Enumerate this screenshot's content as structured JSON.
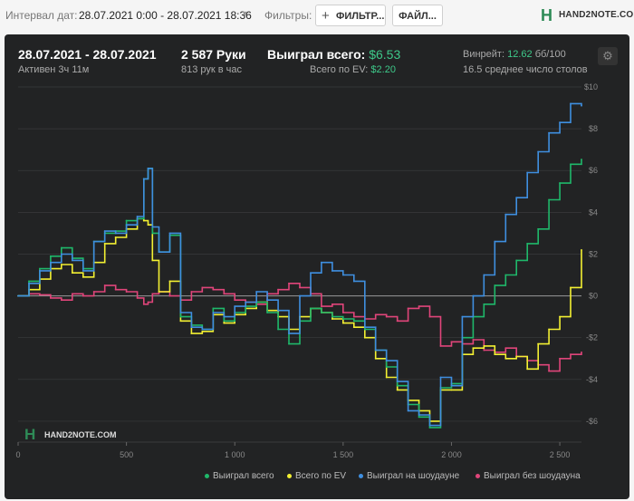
{
  "toolbar": {
    "interval_label": "Интервал дат:",
    "interval_value": "28.07.2021 0:00 - 28.07.2021 18:36",
    "filters_label": "Фильтры:",
    "filter_button": "ФИЛЬТР...",
    "file_button": "ФАЙЛ...",
    "logo_text": "HAND2NOTE.COM"
  },
  "stats": {
    "date_range": "28.07.2021 - 28.07.2021",
    "active": "Активен 3ч 11м",
    "hands": "2 587 Руки",
    "hands_per_hour": "813 рук в час",
    "won_total_label": "Выиграл всего:",
    "won_total_value": "$6.53",
    "ev_label": "Всего по EV:",
    "ev_value": "$2.20",
    "winrate_label": "Винрейт:",
    "winrate_value": "12.62",
    "winrate_unit": "бб/100",
    "avg_tables": "16.5 среднее число столов"
  },
  "watermark": "HAND2NOTE.COM",
  "colors": {
    "green": "#1fb86a",
    "yellow": "#f3f032",
    "blue": "#3f8fe0",
    "pink": "#e0457a"
  },
  "chart_data": {
    "type": "line",
    "xlim": [
      0,
      2600
    ],
    "ylim": [
      -7,
      10
    ],
    "x_ticks": [
      0,
      500,
      1000,
      1500,
      2000,
      2500
    ],
    "x_tick_labels": [
      "0",
      "500",
      "1 000",
      "1 500",
      "2 000",
      "2 500"
    ],
    "y_ticks": [
      -6,
      -4,
      -2,
      0,
      2,
      4,
      6,
      8,
      10
    ],
    "y_tick_labels": [
      "-$6",
      "-$4",
      "-$2",
      "$0",
      "$2",
      "$4",
      "$6",
      "$8",
      "$10"
    ],
    "legend_position": "bottom-right",
    "series": [
      {
        "name": "Выиграл всего",
        "color": "#1fb86a",
        "x": [
          0,
          50,
          100,
          150,
          200,
          250,
          300,
          350,
          400,
          450,
          500,
          550,
          580,
          600,
          620,
          650,
          700,
          750,
          800,
          850,
          900,
          950,
          1000,
          1050,
          1100,
          1150,
          1200,
          1250,
          1300,
          1350,
          1400,
          1450,
          1500,
          1550,
          1600,
          1650,
          1700,
          1750,
          1800,
          1850,
          1900,
          1950,
          2000,
          2050,
          2100,
          2150,
          2200,
          2250,
          2300,
          2350,
          2400,
          2450,
          2500,
          2550,
          2600
        ],
        "y": [
          0,
          0.7,
          1.3,
          1.9,
          2.3,
          1.8,
          1.3,
          2.6,
          3.0,
          3.1,
          3.6,
          3.7,
          5.6,
          6.1,
          3.0,
          2.1,
          2.9,
          -1.0,
          -1.4,
          -1.6,
          -0.6,
          -1.2,
          -0.8,
          -0.5,
          -0.3,
          -0.8,
          -1.6,
          -2.3,
          -1.2,
          -0.6,
          -0.8,
          -1.0,
          -1.1,
          -1.2,
          -1.6,
          -2.6,
          -3.4,
          -4.3,
          -5.2,
          -5.8,
          -6.3,
          -4.4,
          -4.2,
          -2.0,
          -1.0,
          -0.4,
          0.5,
          1.0,
          1.7,
          2.5,
          3.2,
          4.6,
          5.4,
          6.3,
          6.53
        ]
      },
      {
        "name": "Всего по EV",
        "color": "#f3f032",
        "x": [
          0,
          50,
          100,
          150,
          200,
          250,
          300,
          350,
          400,
          450,
          500,
          550,
          580,
          600,
          620,
          650,
          700,
          750,
          800,
          850,
          900,
          950,
          1000,
          1050,
          1100,
          1150,
          1200,
          1250,
          1300,
          1350,
          1400,
          1450,
          1500,
          1550,
          1600,
          1650,
          1700,
          1750,
          1800,
          1850,
          1900,
          1950,
          2000,
          2050,
          2100,
          2150,
          2200,
          2250,
          2300,
          2350,
          2400,
          2450,
          2500,
          2550,
          2600
        ],
        "y": [
          0,
          0.3,
          0.8,
          1.3,
          1.5,
          1.1,
          0.9,
          1.6,
          2.5,
          2.8,
          3.2,
          3.7,
          3.6,
          3.4,
          1.7,
          0.2,
          0.7,
          -1.2,
          -1.8,
          -1.7,
          -0.9,
          -1.3,
          -0.9,
          -0.6,
          -0.3,
          -0.7,
          -1.0,
          -1.6,
          -1.0,
          -0.6,
          -0.8,
          -1.1,
          -1.3,
          -1.5,
          -2.0,
          -3.0,
          -3.9,
          -4.5,
          -5.0,
          -5.5,
          -6.0,
          -4.5,
          -4.5,
          -2.8,
          -2.5,
          -2.4,
          -2.8,
          -3.0,
          -2.9,
          -3.5,
          -2.3,
          -1.6,
          -1.0,
          0.4,
          2.2
        ]
      },
      {
        "name": "Выиграл на шоудауне",
        "color": "#3f8fe0",
        "x": [
          0,
          50,
          100,
          150,
          200,
          250,
          300,
          350,
          400,
          450,
          500,
          550,
          580,
          600,
          620,
          650,
          700,
          750,
          800,
          850,
          900,
          950,
          1000,
          1050,
          1100,
          1150,
          1200,
          1250,
          1300,
          1350,
          1400,
          1450,
          1500,
          1550,
          1600,
          1650,
          1700,
          1750,
          1800,
          1850,
          1900,
          1950,
          2000,
          2050,
          2100,
          2150,
          2200,
          2250,
          2300,
          2350,
          2400,
          2450,
          2500,
          2550,
          2600
        ],
        "y": [
          0,
          0.6,
          1.2,
          1.6,
          2.0,
          1.7,
          1.2,
          2.6,
          3.1,
          3.0,
          3.4,
          3.8,
          5.6,
          6.1,
          3.3,
          2.1,
          3.0,
          -0.8,
          -1.5,
          -1.6,
          -0.8,
          -1.0,
          -0.5,
          -0.3,
          0.2,
          -0.2,
          -0.7,
          -1.8,
          0.0,
          1.1,
          1.6,
          1.2,
          1.0,
          0.7,
          -1.5,
          -2.6,
          -3.1,
          -4.1,
          -5.5,
          -5.7,
          -6.2,
          -3.9,
          -4.3,
          -1.0,
          0.0,
          1.0,
          2.6,
          3.9,
          4.7,
          5.9,
          6.9,
          7.8,
          8.3,
          9.2,
          9.1
        ]
      },
      {
        "name": "Выиграл без шоудауна",
        "color": "#e0457a",
        "x": [
          0,
          50,
          100,
          150,
          200,
          250,
          300,
          350,
          400,
          450,
          500,
          550,
          580,
          600,
          620,
          650,
          700,
          750,
          800,
          850,
          900,
          950,
          1000,
          1050,
          1100,
          1150,
          1200,
          1250,
          1300,
          1350,
          1400,
          1450,
          1500,
          1550,
          1600,
          1650,
          1700,
          1750,
          1800,
          1850,
          1900,
          1950,
          2000,
          2050,
          2100,
          2150,
          2200,
          2250,
          2300,
          2350,
          2400,
          2450,
          2500,
          2550,
          2600
        ],
        "y": [
          0,
          0.1,
          0.05,
          -0.1,
          -0.2,
          0.1,
          0.0,
          0.2,
          0.5,
          0.3,
          0.2,
          -0.1,
          -0.4,
          -0.3,
          0.1,
          0.2,
          0.0,
          -0.2,
          0.2,
          0.4,
          0.3,
          0.1,
          -0.2,
          -0.3,
          -0.4,
          0.1,
          0.3,
          0.6,
          0.4,
          0.1,
          -0.5,
          -0.4,
          -0.8,
          -1.0,
          -1.1,
          -0.9,
          -1.0,
          -1.2,
          -0.6,
          -0.5,
          -1.0,
          -2.4,
          -2.2,
          -2.3,
          -2.1,
          -2.6,
          -2.7,
          -2.5,
          -2.9,
          -3.1,
          -3.3,
          -3.6,
          -3.0,
          -2.8,
          -2.7
        ]
      }
    ]
  }
}
